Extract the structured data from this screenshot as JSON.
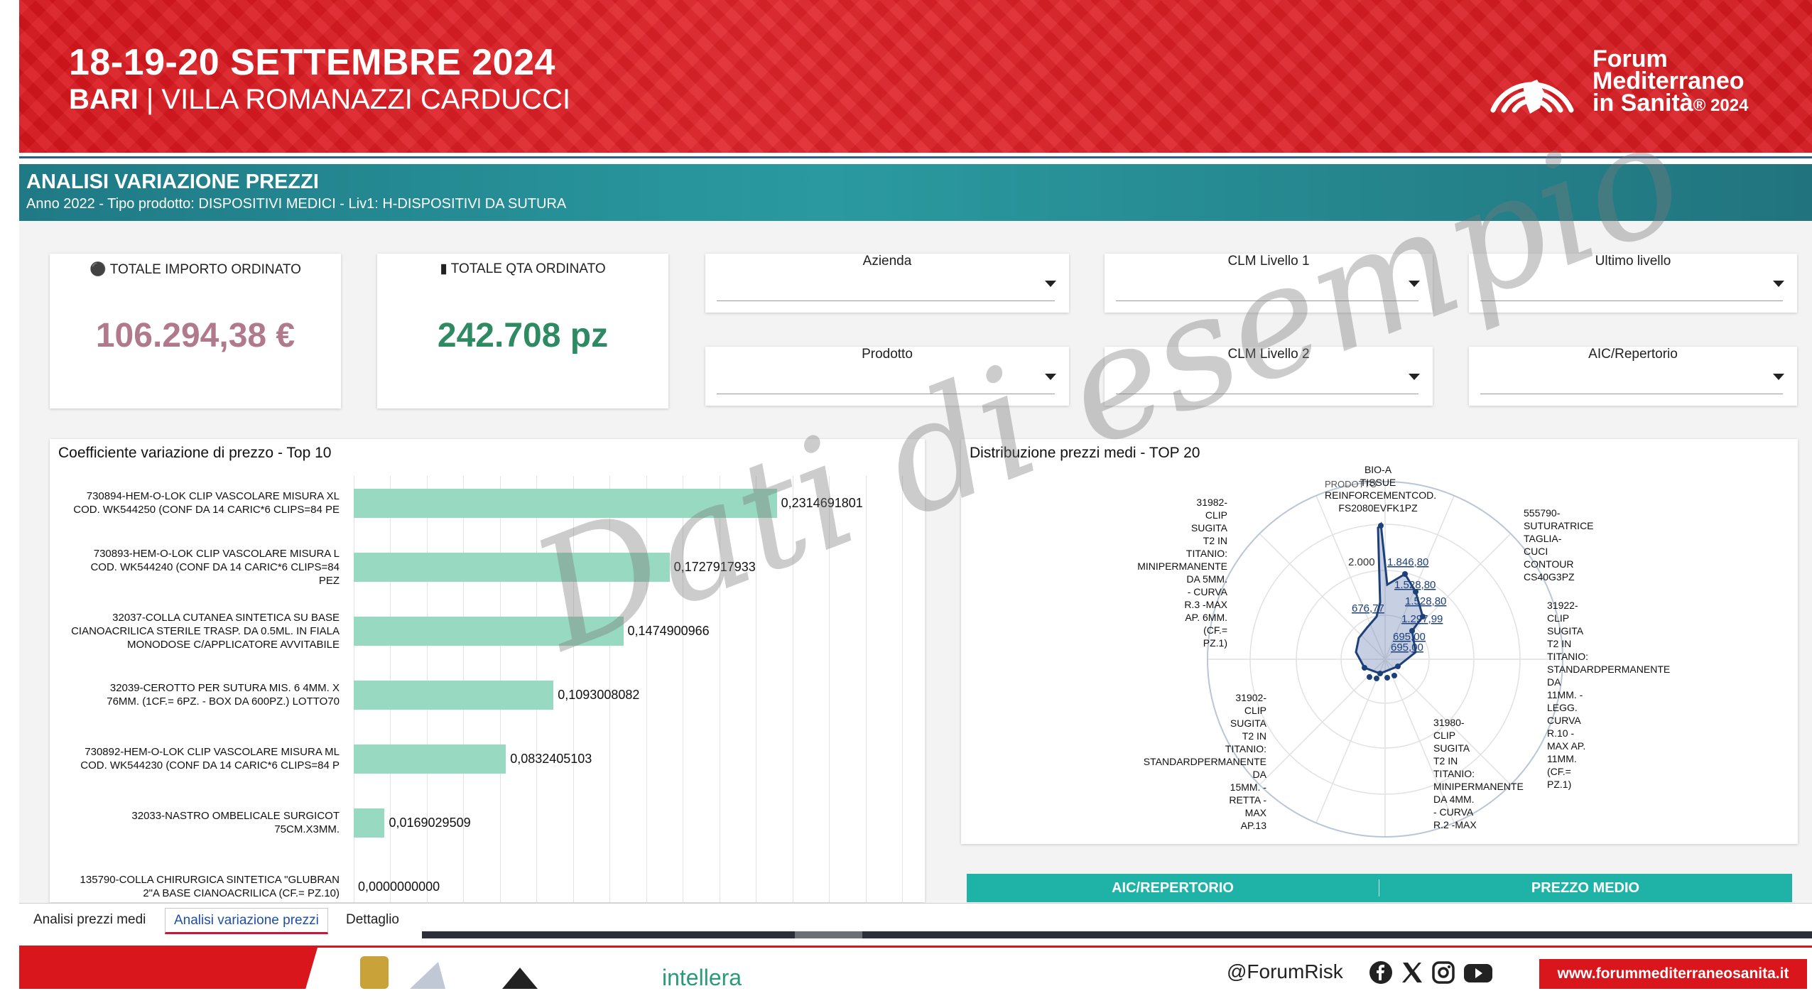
{
  "banner": {
    "date": "18-19-20 SETTEMBRE 2024",
    "city": "BARI",
    "separator": "|",
    "venue": "VILLA ROMANAZZI CARDUCCI",
    "logo_line1": "Forum",
    "logo_line2": "Mediterraneo",
    "logo_line3": "in Sanità",
    "logo_year": "® 2024"
  },
  "report": {
    "title": "ANALISI VARIAZIONE PREZZI",
    "subtitle": "Anno 2022 - Tipo prodotto: DISPOSITIVI MEDICI - Liv1: H-DISPOSITIVI DA SUTURA"
  },
  "kpis": {
    "importo_label": "TOTALE IMPORTO ORDINATO",
    "importo_value": "106.294,38 €",
    "qta_label": "TOTALE QTA ORDINATO",
    "qta_value": "242.708 pz",
    "importo_color": "#b07a8c",
    "qta_color": "#2e8a63"
  },
  "filters": {
    "azienda": "Azienda",
    "clm1": "CLM Livello 1",
    "ultimo": "Ultimo livello",
    "prodotto": "Prodotto",
    "clm2": "CLM Livello 2",
    "aic": "AIC/Repertorio"
  },
  "bar_panel": {
    "title": "Coefficiente variazione di prezzo - Top 10"
  },
  "chart_data": {
    "type": "bar",
    "orientation": "horizontal",
    "title": "Coefficiente variazione di prezzo - Top 10",
    "xlim": [
      0,
      0.3
    ],
    "categories": [
      [
        "730894-HEM-O-LOK CLIP VASCOLARE MISURA XL",
        "COD. WK544250 (CONF DA 14 CARIC*6 CLIPS=84 PE"
      ],
      [
        "730893-HEM-O-LOK CLIP VASCOLARE MISURA L",
        "COD. WK544240 (CONF DA 14 CARIC*6 CLIPS=84",
        "PEZ"
      ],
      [
        "32037-COLLA CUTANEA SINTETICA SU BASE",
        "CIANOACRILICA STERILE TRASP. DA 0.5ML. IN FIALA",
        "MONODOSE C/APPLICATORE AVVITABILE"
      ],
      [
        "32039-CEROTTO PER SUTURA MIS. 6 4MM. X",
        "76MM. (1CF.= 6PZ. - BOX DA 600PZ.) LOTTO70"
      ],
      [
        "730892-HEM-O-LOK CLIP VASCOLARE MISURA ML",
        "COD. WK544230 (CONF DA 14 CARIC*6 CLIPS=84 P"
      ],
      [
        "32033-NASTRO OMBELICALE SURGICOT",
        "75CM.X3MM."
      ],
      [
        "135790-COLLA CHIRURGICA SINTETICA \"GLUBRAN",
        "2\"A BASE CIANOACRILICA (CF.= PZ.10)"
      ]
    ],
    "values": [
      0.2314691801,
      0.1727917933,
      0.1474900966,
      0.1093008082,
      0.0832405103,
      0.0169029509,
      0.0
    ],
    "value_labels": [
      "0,2314691801",
      "0,1727917933",
      "0,1474900966",
      "0,1093008082",
      "0,0832405103",
      "0,0169029509",
      "0,0000000000"
    ]
  },
  "polar_panel": {
    "title": "Distribuzione prezzi medi - TOP 20",
    "top_label": [
      "BIO-A",
      "TISSUE",
      "REINFORCEMENTCOD.",
      "FS2080EVFK1PZ"
    ],
    "top_label_overlay": "PRODOTTO",
    "left_label": [
      "31982-",
      "CLIP",
      "SUGITA",
      "T2 IN",
      "TITANIO:",
      "MINIPERMANENTE",
      "DA 5MM.",
      "- CURVA",
      "R.3 -MAX",
      "AP. 6MM.",
      "(CF.=",
      "PZ.1)"
    ],
    "right_label": [
      "555790-",
      "SUTURATRICE",
      "TAGLIA-",
      "CUCI",
      "CONTOUR",
      "CS40G3PZ"
    ],
    "right2_label": [
      "31922-",
      "CLIP",
      "SUGITA",
      "T2 IN",
      "TITANIO:",
      "STANDARDPERMANENTE",
      "DA",
      "11MM. -",
      "LEGG.",
      "CURVA",
      "R.10 -",
      "MAX AP.",
      "11MM.",
      "(CF.=",
      "PZ.1)"
    ],
    "bottom_left_label": [
      "31902-",
      "CLIP",
      "SUGITA",
      "T2 IN",
      "TITANIO:",
      "STANDARDPERMANENTE",
      "DA",
      "15MM. -",
      "RETTA -",
      "MAX",
      "AP.13"
    ],
    "bottom_right_label": [
      "31980-",
      "CLIP",
      "SUGITA",
      "T2 IN",
      "TITANIO:",
      "MINIPERMANENTE",
      "DA 4MM.",
      "- CURVA",
      "R.2 -MAX"
    ],
    "axis_label": "2.000",
    "value_labels": [
      "1.846,80",
      "1.528,80",
      "1.528,80",
      "1.297,99",
      "695,00",
      "695,00",
      "676,77"
    ]
  },
  "table": {
    "col1": "AIC/REPERTORIO",
    "col2": "PREZZO MEDIO"
  },
  "tabs": {
    "t1": "Analisi prezzi medi",
    "t2": "Analisi variazione prezzi",
    "t3": "Dettaglio"
  },
  "footer": {
    "handle": "@ForumRisk",
    "website": "www.forummediterraneosanita.it",
    "partner_text": "intellera"
  },
  "watermark": "Dati di esempio"
}
